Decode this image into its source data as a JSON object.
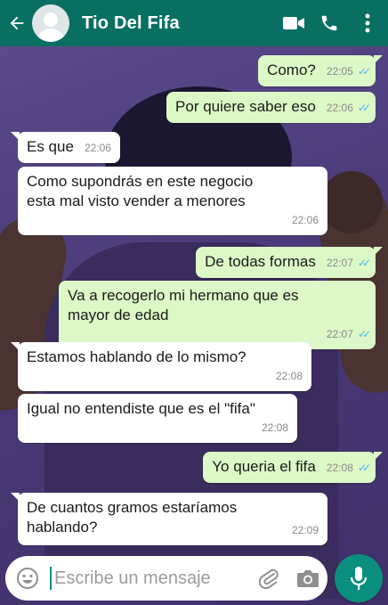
{
  "header": {
    "contact_name": "Tio Del Fifa",
    "icons": [
      "back-arrow-icon",
      "avatar",
      "video-call-icon",
      "phone-icon",
      "more-vertical-icon"
    ]
  },
  "messages": [
    {
      "direction": "out",
      "text": "Como?",
      "time": "22:05",
      "read": true
    },
    {
      "direction": "out",
      "text": "Por quiere saber eso",
      "time": "22:06",
      "read": true
    },
    {
      "direction": "in",
      "text": "Es que",
      "time": "22:06"
    },
    {
      "direction": "in",
      "text": "Como supondrás en este negocio\nesta mal visto vender a menores",
      "time": "22:06"
    },
    {
      "direction": "out",
      "text": "De todas formas",
      "time": "22:07",
      "read": true
    },
    {
      "direction": "out",
      "text": "Va a recogerlo mi hermano que es\nmayor de edad",
      "time": "22:07",
      "read": true
    },
    {
      "direction": "in",
      "text": "Estamos hablando de lo mismo?",
      "time": "22:08"
    },
    {
      "direction": "in",
      "text": "Igual no entendiste que es el \"fifa\"",
      "time": "22:08"
    },
    {
      "direction": "out",
      "text": "Yo queria el fifa",
      "time": "22:08",
      "read": true
    },
    {
      "direction": "in",
      "text": "De cuantos gramos estaríamos\nhablando?",
      "time": "22:09"
    }
  ],
  "composer": {
    "placeholder": "Escribe un mensaje",
    "icons": [
      "emoji-icon",
      "attach-icon",
      "camera-icon",
      "mic-icon"
    ]
  },
  "colors": {
    "header": "#0a6f63",
    "outgoing_bubble": "#dcf8c6",
    "incoming_bubble": "#ffffff",
    "read_ticks": "#4fb6ec",
    "accent": "#0a8f7f"
  }
}
